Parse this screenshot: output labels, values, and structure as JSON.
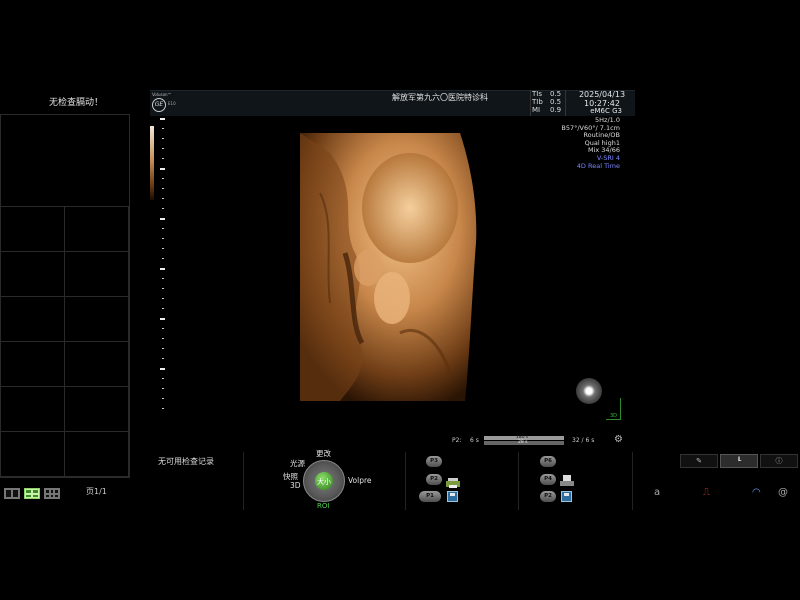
{
  "left_panel": {
    "status_text": "无检查膈动！",
    "page_label": "页1/1",
    "layout_buttons": [
      "layout-1x2",
      "layout-2x2",
      "layout-3x3"
    ],
    "active_layout": "layout-2x2"
  },
  "header": {
    "brand_small": "Voluson™",
    "brand_logo": "GE",
    "brand_model": "E10",
    "hospital": "解放军第九六〇医院特诊科",
    "indices": [
      {
        "label": "TIs",
        "value": "0.5"
      },
      {
        "label": "TIb",
        "value": "0.5"
      },
      {
        "label": "MI",
        "value": "0.9"
      }
    ],
    "date": "2025/04/13",
    "time": "10:27:42",
    "probe": "eM6C G3"
  },
  "params": {
    "lines": [
      "5Hz/1.0",
      "B57°/V60°/ 7.1cm",
      "Routine/OB",
      "Qual high1",
      "Mix 34/66"
    ],
    "blue_lines": [
      "V-SRI 4",
      "4D Real Time"
    ],
    "blue_color": "#7a86ff"
  },
  "render": {
    "mode": "3D",
    "tint_color": "#c8874a"
  },
  "cine": {
    "label": "P2:",
    "left_value": "6 s",
    "bar_top": "180 s",
    "bar_bottom": "28 s",
    "right_value": "32 / 6 s"
  },
  "bottom": {
    "no_record": "无可用检查记录",
    "dial": {
      "top": "更改",
      "left_top": "光源",
      "left_mid": "快照",
      "left_bottom": "3D",
      "right": "Volpre",
      "center": "大小",
      "bottom": "ROI",
      "accent": "#4cd14c"
    },
    "group1": [
      "P3",
      "P2",
      "P1"
    ],
    "group2": [
      "P6",
      "P4",
      "P2"
    ]
  },
  "tabs": [
    {
      "icon": "edit-icon",
      "glyph": "✎"
    },
    {
      "icon": "chart-icon",
      "glyph": "╙"
    },
    {
      "icon": "info-icon",
      "glyph": "ⓘ"
    }
  ],
  "sys_icons": [
    {
      "name": "a-icon",
      "glyph": "a"
    },
    {
      "name": "network-icon",
      "glyph": "⎍"
    },
    {
      "name": "wifi-icon",
      "glyph": "◠"
    },
    {
      "name": "at-icon",
      "glyph": "@"
    }
  ]
}
